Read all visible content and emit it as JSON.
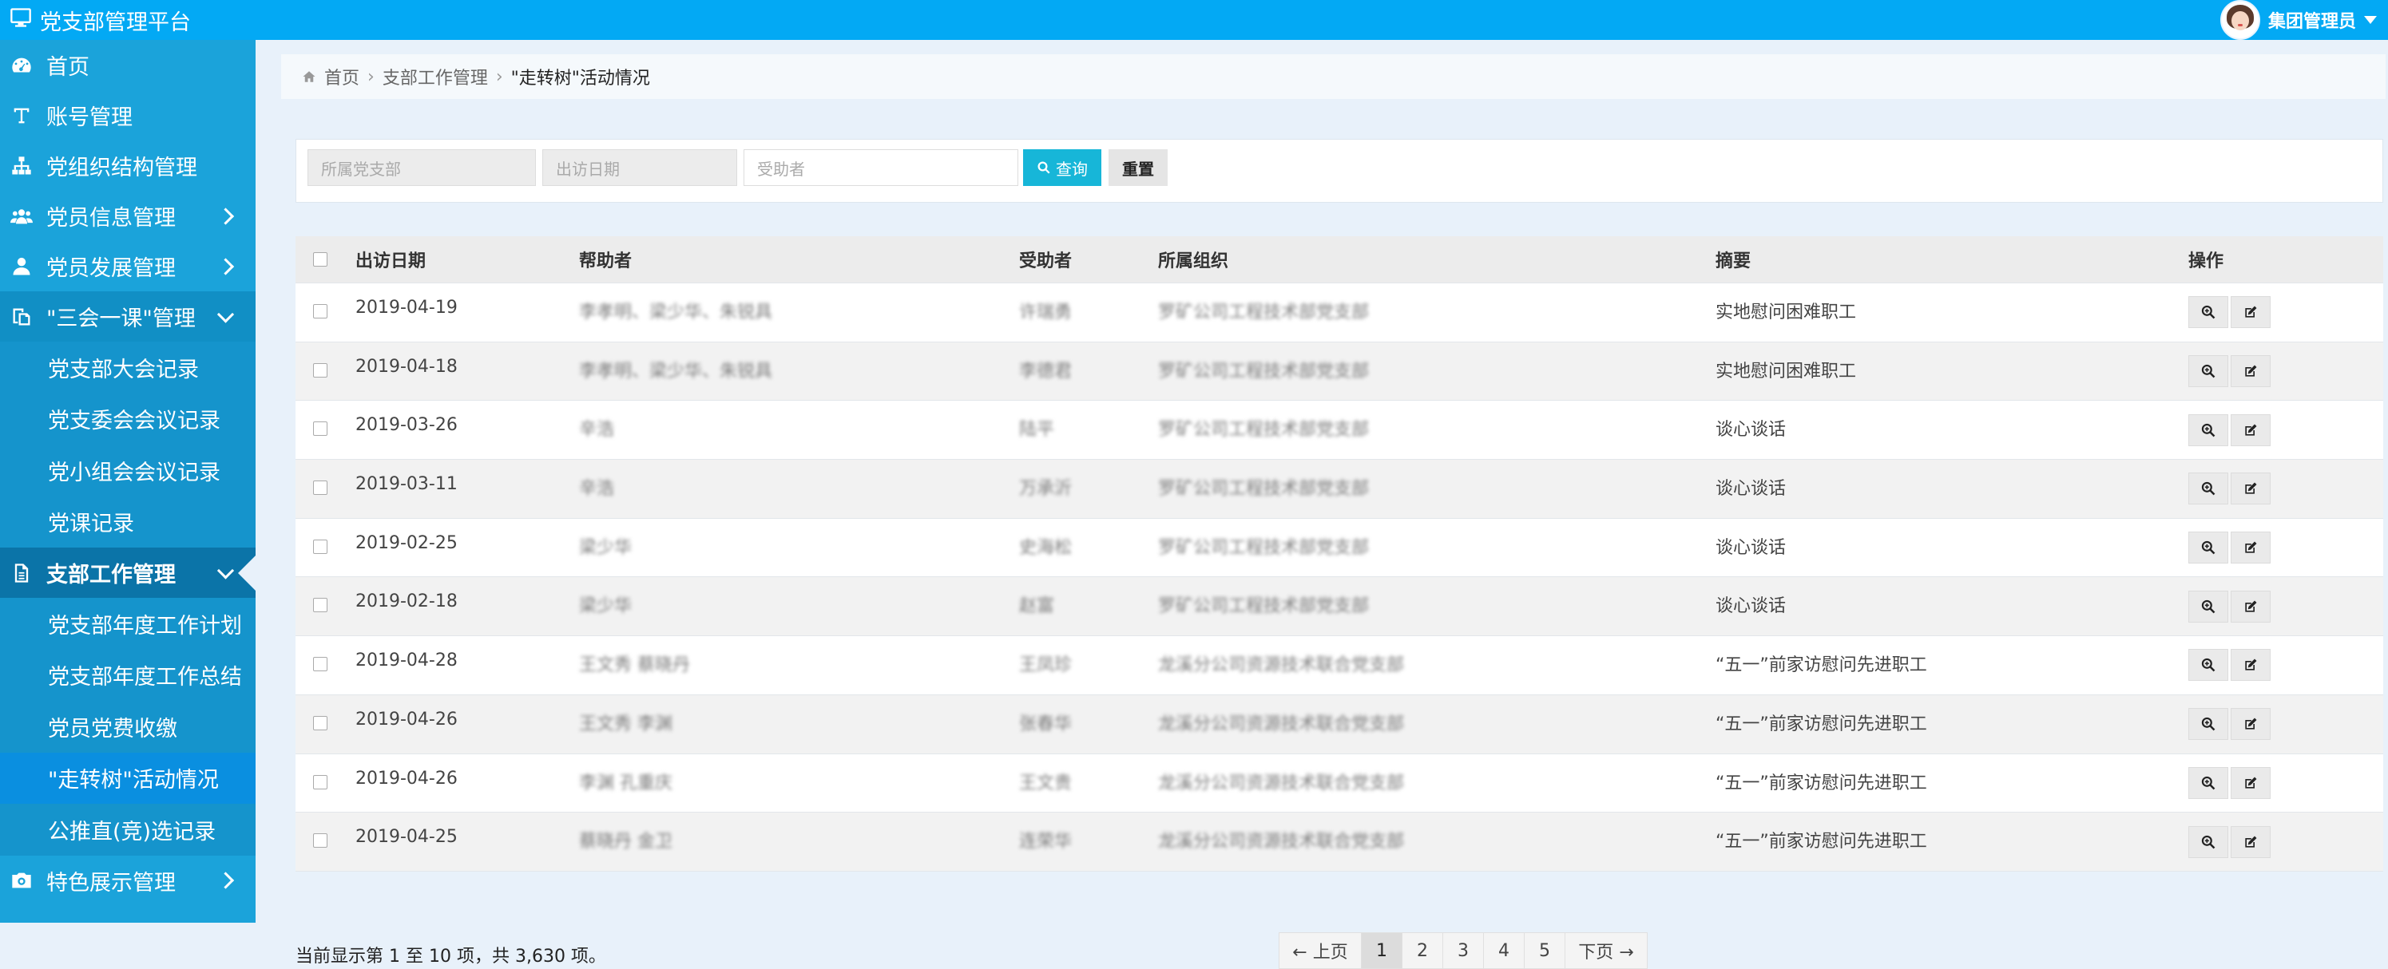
{
  "app": {
    "title": "党支部管理平台",
    "user": "集团管理员"
  },
  "sidebar": {
    "items": [
      {
        "label": "首页",
        "icon": "dashboard-icon"
      },
      {
        "label": "账号管理",
        "icon": "text-icon"
      },
      {
        "label": "党组织结构管理",
        "icon": "sitemap-icon"
      },
      {
        "label": "党员信息管理",
        "icon": "users-icon"
      },
      {
        "label": "党员发展管理",
        "icon": "user-icon"
      },
      {
        "label": "\"三会一课\"管理",
        "icon": "copy-icon"
      },
      {
        "label": "党支部大会记录"
      },
      {
        "label": "党支委会会议记录"
      },
      {
        "label": "党小组会会议记录"
      },
      {
        "label": "党课记录"
      },
      {
        "label": "支部工作管理",
        "icon": "file-icon"
      },
      {
        "label": "党支部年度工作计划"
      },
      {
        "label": "党支部年度工作总结"
      },
      {
        "label": "党员党费收缴"
      },
      {
        "label": "\"走转树\"活动情况"
      },
      {
        "label": "公推直(竞)选记录"
      },
      {
        "label": "特色展示管理",
        "icon": "camera-icon"
      }
    ]
  },
  "breadcrumb": {
    "home": "首页",
    "level1": "支部工作管理",
    "current": "\"走转树\"活动情况"
  },
  "filters": {
    "branch_placeholder": "所属党支部",
    "date_placeholder": "出访日期",
    "recipient_placeholder": "受助者",
    "query_label": "查询",
    "reset_label": "重置"
  },
  "table": {
    "headers": [
      "出访日期",
      "帮助者",
      "受助者",
      "所属组织",
      "摘要",
      "操作"
    ],
    "rows": [
      {
        "date": "2019-04-19",
        "helpers": "李孝明、梁少华、朱锐具",
        "recipient": "许瑞勇",
        "org": "罗矿公司工程技术部党支部",
        "summary": "实地慰问困难职工"
      },
      {
        "date": "2019-04-18",
        "helpers": "李孝明、梁少华、朱锐具",
        "recipient": "李德君",
        "org": "罗矿公司工程技术部党支部",
        "summary": "实地慰问困难职工"
      },
      {
        "date": "2019-03-26",
        "helpers": "辛浩",
        "recipient": "陆平",
        "org": "罗矿公司工程技术部党支部",
        "summary": "谈心谈话"
      },
      {
        "date": "2019-03-11",
        "helpers": "辛浩",
        "recipient": "万承沂",
        "org": "罗矿公司工程技术部党支部",
        "summary": "谈心谈话"
      },
      {
        "date": "2019-02-25",
        "helpers": "梁少华",
        "recipient": "史海松",
        "org": "罗矿公司工程技术部党支部",
        "summary": "谈心谈话"
      },
      {
        "date": "2019-02-18",
        "helpers": "梁少华",
        "recipient": "赵富",
        "org": "罗矿公司工程技术部党支部",
        "summary": "谈心谈话"
      },
      {
        "date": "2019-04-28",
        "helpers": "王文秀 蔡晓丹",
        "recipient": "王凤珍",
        "org": "龙溪分公司资源技术联合党支部",
        "summary": "“五一”前家访慰问先进职工"
      },
      {
        "date": "2019-04-26",
        "helpers": "王文秀 李渊",
        "recipient": "张春华",
        "org": "龙溪分公司资源技术联合党支部",
        "summary": "“五一”前家访慰问先进职工"
      },
      {
        "date": "2019-04-26",
        "helpers": "李渊 孔重庆",
        "recipient": "王文贵",
        "org": "龙溪分公司资源技术联合党支部",
        "summary": "“五一”前家访慰问先进职工"
      },
      {
        "date": "2019-04-25",
        "helpers": "蔡晓丹 金卫",
        "recipient": "连荣华",
        "org": "龙溪分公司资源技术联合党支部",
        "summary": "“五一”前家访慰问先进职工"
      }
    ]
  },
  "footer": {
    "info": "当前显示第 1 至 10 项，共 3,630 项。",
    "prev": "← 上页",
    "pages": [
      "1",
      "2",
      "3",
      "4",
      "5"
    ],
    "next": "下页 →"
  },
  "colors": {
    "topbar": "#03a9f4",
    "sidebar": "#1ba3da",
    "sidebar_active": "#0b74a8",
    "query_button": "#17b6d8"
  }
}
